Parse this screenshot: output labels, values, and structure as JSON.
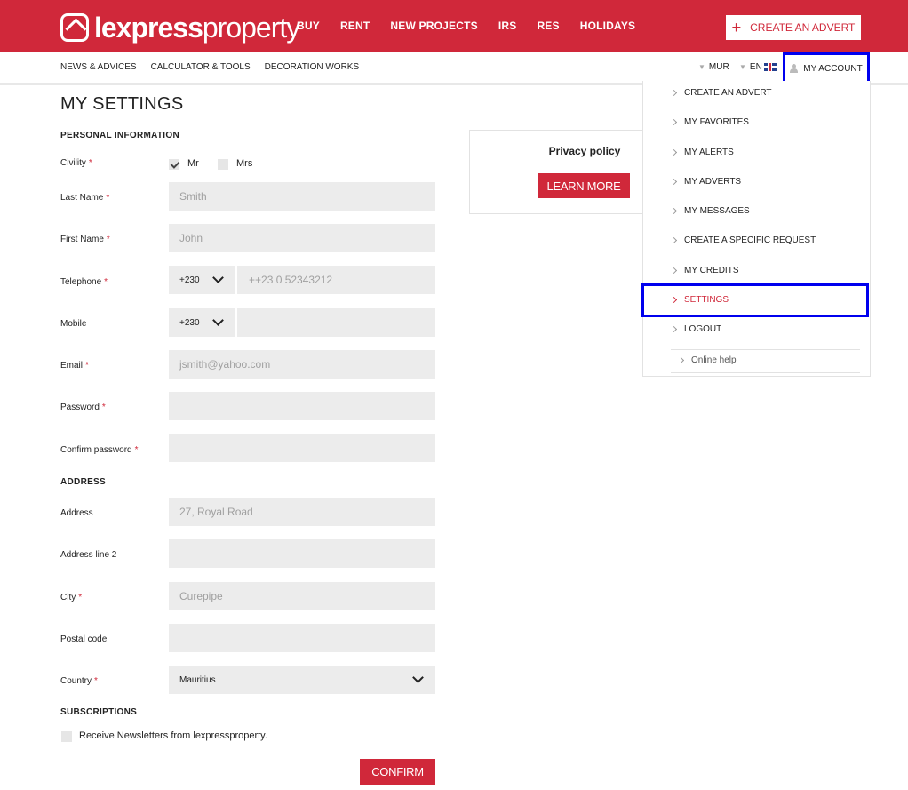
{
  "header": {
    "logo_bold": "lexpress",
    "logo_light": "property",
    "nav": [
      "BUY",
      "RENT",
      "NEW PROJECTS",
      "IRS",
      "RES",
      "HOLIDAYS"
    ],
    "create_advert_label": "CREATE AN ADVERT",
    "create_advert_icon": "plus-icon"
  },
  "subnav": {
    "links": [
      "NEWS & ADVICES",
      "CALCULATOR & TOOLS",
      "DECORATION WORKS"
    ],
    "currency": "MUR",
    "language": "EN",
    "account_label": "MY ACCOUNT"
  },
  "page": {
    "title": "MY SETTINGS",
    "sections": {
      "personal": "PERSONAL INFORMATION",
      "address": "ADDRESS",
      "subscriptions": "SUBSCRIPTIONS"
    }
  },
  "form": {
    "civility_label": "Civility",
    "civility_options": [
      "Mr",
      "Mrs"
    ],
    "civility_selected": "Mr",
    "last_name_label": "Last Name",
    "last_name_placeholder": "Smith",
    "first_name_label": "First Name",
    "first_name_placeholder": "John",
    "telephone_label": "Telephone",
    "telephone_code": "+230",
    "telephone_placeholder": "++23 0 52343212",
    "mobile_label": "Mobile",
    "mobile_code": "+230",
    "mobile_placeholder": "",
    "email_label": "Email",
    "email_placeholder": "jsmith@yahoo.com",
    "password_label": "Password",
    "confirm_password_label": "Confirm password",
    "address_label": "Address",
    "address_placeholder": "27, Royal Road",
    "address2_label": "Address line 2",
    "city_label": "City",
    "city_placeholder": "Curepipe",
    "postal_label": "Postal code",
    "country_label": "Country",
    "country_value": "Mauritius",
    "newsletter_label": "Receive Newsletters from lexpressproperty.",
    "newsletter_checked": false,
    "required_mark": "*",
    "confirm_label": "CONFIRM"
  },
  "privacy": {
    "title": "Privacy policy",
    "button_label": "LEARN MORE"
  },
  "account_menu": {
    "items": [
      "CREATE AN ADVERT",
      "MY FAVORITES",
      "MY ALERTS",
      "MY ADVERTS",
      "MY MESSAGES",
      "CREATE A SPECIFIC REQUEST",
      "MY CREDITS",
      "SETTINGS",
      "LOGOUT"
    ],
    "active_item": "SETTINGS",
    "help_label": "Online help"
  },
  "colors": {
    "brand_red": "#d0283a",
    "highlight_blue": "#0000ee",
    "field_bg": "#ececec"
  }
}
